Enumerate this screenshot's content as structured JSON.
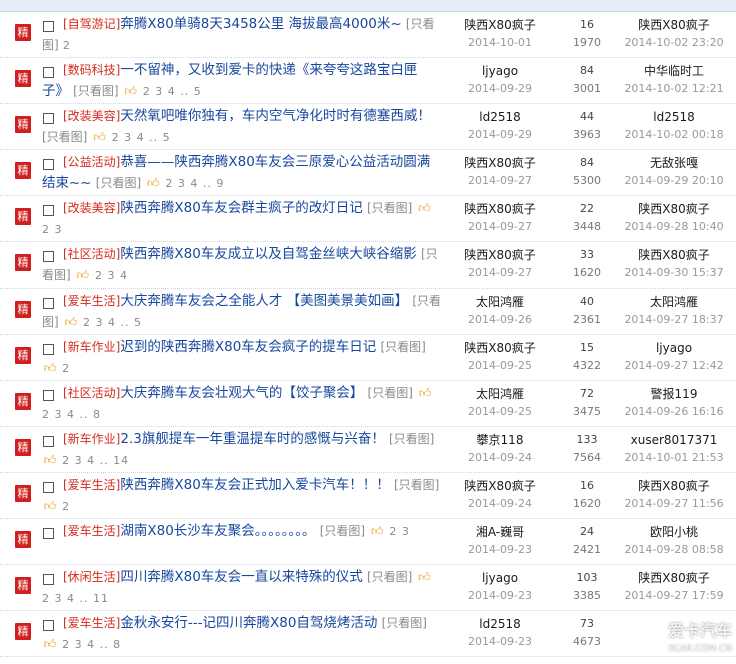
{
  "header": {
    "title": ""
  },
  "badge_label": "精",
  "threads": [
    {
      "category": "[自驾游记]",
      "title": "奔腾X80单骑8天3458公里 海拔最高4000米~",
      "only_pic": "[只看图]",
      "thumb": false,
      "pages": "2",
      "author": "陕西X80疯子",
      "date": "2014-10-01",
      "replies": "16",
      "views": "1970",
      "last_user": "陕西X80疯子",
      "last_time": "2014-10-02 23:20"
    },
    {
      "category": "[数码科技]",
      "title": "一不留神，又收到爱卡的快递《来夸夸这路宝白匣子》",
      "only_pic": "[只看图]",
      "thumb": true,
      "pages": "2 3 4 .. 5",
      "author": "ljyago",
      "date": "2014-09-29",
      "replies": "84",
      "views": "3001",
      "last_user": "中华临时工",
      "last_time": "2014-10-02 12:21"
    },
    {
      "category": "[改装美容]",
      "title": "天然氧吧唯你独有，车内空气净化时时有德塞西威！",
      "only_pic": "[只看图]",
      "thumb": true,
      "pages": "2 3 4 .. 5",
      "author": "ld2518",
      "date": "2014-09-29",
      "replies": "44",
      "views": "3963",
      "last_user": "ld2518",
      "last_time": "2014-10-02 00:18"
    },
    {
      "category": "[公益活动]",
      "title": "恭喜——陕西奔腾X80车友会三原爱心公益活动圆满结束~~",
      "only_pic": "[只看图]",
      "thumb": true,
      "pages": "2 3 4 .. 9",
      "author": "陕西X80疯子",
      "date": "2014-09-27",
      "replies": "84",
      "views": "5300",
      "last_user": "无敌张嘎",
      "last_time": "2014-09-29 20:10"
    },
    {
      "category": "[改装美容]",
      "title": "陕西奔腾X80车友会群主疯子的改灯日记",
      "only_pic": "[只看图]",
      "thumb": true,
      "pages": "2 3",
      "author": "陕西X80疯子",
      "date": "2014-09-27",
      "replies": "22",
      "views": "3448",
      "last_user": "陕西X80疯子",
      "last_time": "2014-09-28 10:40"
    },
    {
      "category": "[社区活动]",
      "title": "陕西奔腾X80车友成立以及自驾金丝峡大峡谷缩影",
      "only_pic": "[只看图]",
      "thumb": true,
      "pages": "2 3 4",
      "author": "陕西X80疯子",
      "date": "2014-09-27",
      "replies": "33",
      "views": "1620",
      "last_user": "陕西X80疯子",
      "last_time": "2014-09-30 15:37"
    },
    {
      "category": "[爱车生活]",
      "title": "大庆奔腾车友会之全能人才 【美图美景美如画】",
      "only_pic": "[只看图]",
      "thumb": true,
      "pages": "2 3 4 .. 5",
      "author": "太阳鸿雁",
      "date": "2014-09-26",
      "replies": "40",
      "views": "2361",
      "last_user": "太阳鸿雁",
      "last_time": "2014-09-27 18:37"
    },
    {
      "category": "[新车作业]",
      "title": "迟到的陕西奔腾X80车友会疯子的提车日记",
      "only_pic": "[只看图]",
      "thumb": true,
      "pages": "2",
      "author": "陕西X80疯子",
      "date": "2014-09-25",
      "replies": "15",
      "views": "4322",
      "last_user": "ljyago",
      "last_time": "2014-09-27 12:42"
    },
    {
      "category": "[社区活动]",
      "title": "大庆奔腾车友会壮观大气的【饺子聚会】",
      "only_pic": "[只看图]",
      "thumb": true,
      "pages": "2 3 4 .. 8",
      "author": "太阳鸿雁",
      "date": "2014-09-25",
      "replies": "72",
      "views": "3475",
      "last_user": "警报119",
      "last_time": "2014-09-26 16:16"
    },
    {
      "category": "[新车作业]",
      "title": "2.3旗舰提车一年重温提车时的感慨与兴奋！",
      "only_pic": "[只看图]",
      "thumb": true,
      "pages": "2 3 4 .. 14",
      "author": "攀京118",
      "date": "2014-09-24",
      "replies": "133",
      "views": "7564",
      "last_user": "xuser8017371",
      "last_time": "2014-10-01 21:53"
    },
    {
      "category": "[爱车生活]",
      "title": "陕西奔腾X80车友会正式加入爱卡汽车！！！",
      "only_pic": "[只看图]",
      "thumb": true,
      "pages": "2",
      "author": "陕西X80疯子",
      "date": "2014-09-24",
      "replies": "16",
      "views": "1620",
      "last_user": "陕西X80疯子",
      "last_time": "2014-09-27 11:56"
    },
    {
      "category": "[爱车生活]",
      "title": "湖南X80长沙车友聚会。。。。。。。。",
      "only_pic": "[只看图]",
      "thumb": true,
      "pages": "2 3",
      "author": "湘A-巍哥",
      "date": "2014-09-23",
      "replies": "24",
      "views": "2421",
      "last_user": "欧阳小桃",
      "last_time": "2014-09-28 08:58"
    },
    {
      "category": "[休闲生活]",
      "title": "四川奔腾X80车友会一直以来特殊的仪式",
      "only_pic": "[只看图]",
      "thumb": true,
      "pages": "2 3 4 .. 11",
      "author": "ljyago",
      "date": "2014-09-23",
      "replies": "103",
      "views": "3385",
      "last_user": "陕西X80疯子",
      "last_time": "2014-09-27 17:59"
    },
    {
      "category": "[爱车生活]",
      "title": "金秋永安行---记四川奔腾X80自驾烧烤活动",
      "only_pic": "[只看图]",
      "thumb": true,
      "pages": "2 3 4 .. 8",
      "author": "ld2518",
      "date": "2014-09-23",
      "replies": "73",
      "views": "4673",
      "last_user": "",
      "last_time": ""
    }
  ],
  "watermark": {
    "line1": "爱卡汽车",
    "line2": "XCAR.COM.CN"
  },
  "colors": {
    "category": "#d52b1e",
    "title": "#17479e",
    "badge": "#d11f1f",
    "thumb": "#e89a19"
  }
}
